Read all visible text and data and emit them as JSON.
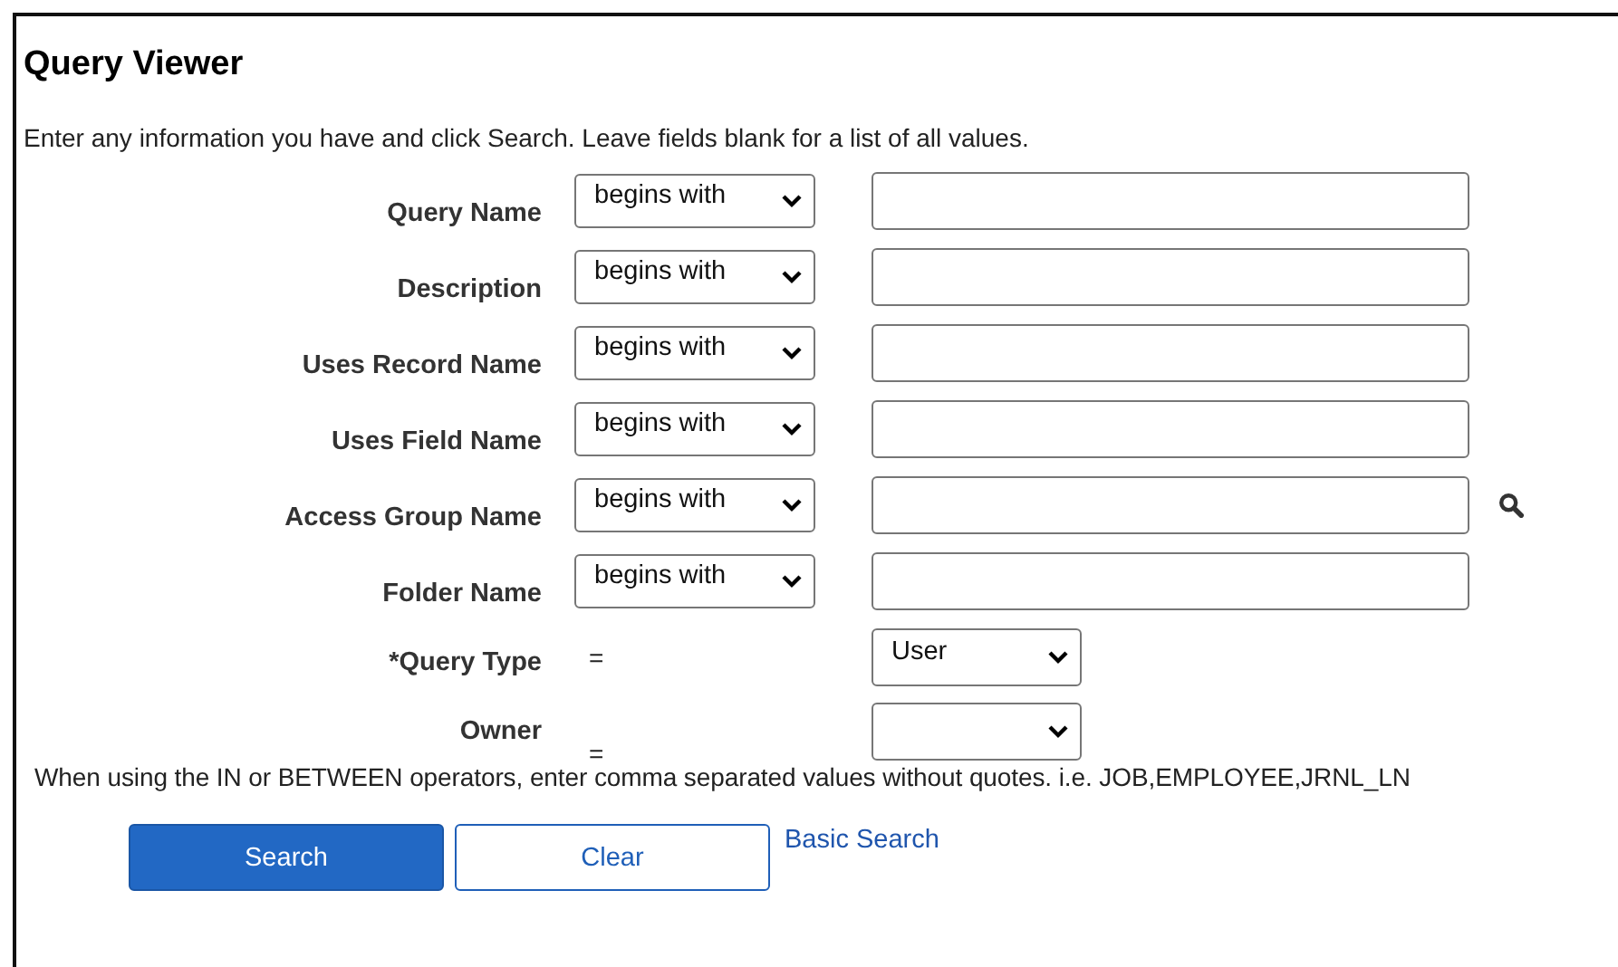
{
  "title": "Query Viewer",
  "instructions": "Enter any information you have and click Search. Leave fields blank for a list of all values.",
  "criteria": [
    {
      "kind": "text",
      "label": "Query Name",
      "operator": "begins with",
      "lookup": false
    },
    {
      "kind": "text",
      "label": "Description",
      "operator": "begins with",
      "lookup": false
    },
    {
      "kind": "text",
      "label": "Uses Record Name",
      "operator": "begins with",
      "lookup": false
    },
    {
      "kind": "text",
      "label": "Uses Field Name",
      "operator": "begins with",
      "lookup": false
    },
    {
      "kind": "text",
      "label": "Access Group Name",
      "operator": "begins with",
      "lookup": true
    },
    {
      "kind": "text",
      "label": "Folder Name",
      "operator": "begins with",
      "lookup": false
    },
    {
      "kind": "choice",
      "label": "*Query Type",
      "operator": "=",
      "value": "User"
    },
    {
      "kind": "choice",
      "label": "Owner",
      "operator": "="
    }
  ],
  "note": "When using the IN or BETWEEN operators, enter comma separated values without quotes. i.e. JOB,EMPLOYEE,JRNL_LN",
  "buttons": [
    {
      "label": "Search",
      "kind": "primary"
    },
    {
      "label": "Clear",
      "kind": "secondary"
    },
    {
      "label": "Basic Search",
      "kind": "link"
    }
  ]
}
